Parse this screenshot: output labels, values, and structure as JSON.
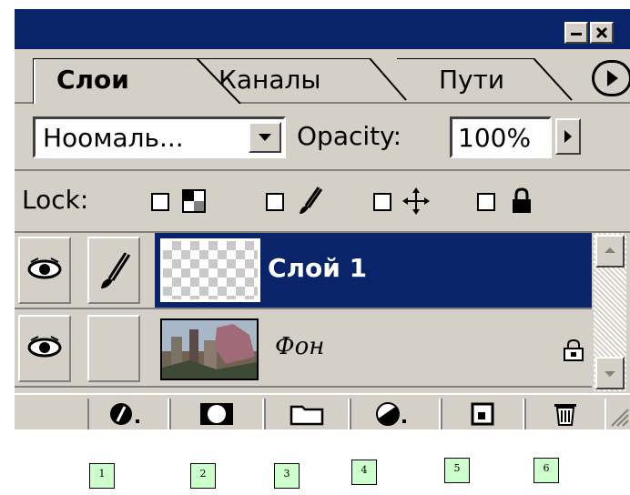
{
  "tabs": [
    {
      "label": "Слои",
      "active": true
    },
    {
      "label": "Каналы",
      "active": false
    },
    {
      "label": "Пути",
      "active": false
    }
  ],
  "blend": {
    "mode_value": "Ноомаль...",
    "opacity_label": "Opacity:",
    "opacity_value": "100%"
  },
  "lock": {
    "label": "Lock:",
    "options": [
      "lock-transparent-pixels",
      "lock-image-pixels",
      "lock-position",
      "lock-all"
    ]
  },
  "layers": [
    {
      "name": "Слой 1",
      "selected": true,
      "visible": true,
      "brush": true,
      "locked": false
    },
    {
      "name": "Фон",
      "selected": false,
      "visible": true,
      "brush": false,
      "locked": true
    }
  ],
  "bottom_buttons": [
    "layer-style",
    "add-mask",
    "new-layer-set",
    "new-fill-adjustment",
    "new-layer",
    "delete-layer"
  ],
  "callouts": [
    "1",
    "2",
    "3",
    "4",
    "5",
    "6"
  ],
  "colors": {
    "title_bar": "#0a246a",
    "selected_layer": "#0a246a",
    "panel": "#d4d0c8",
    "callout_bg": "#ccffcc"
  }
}
